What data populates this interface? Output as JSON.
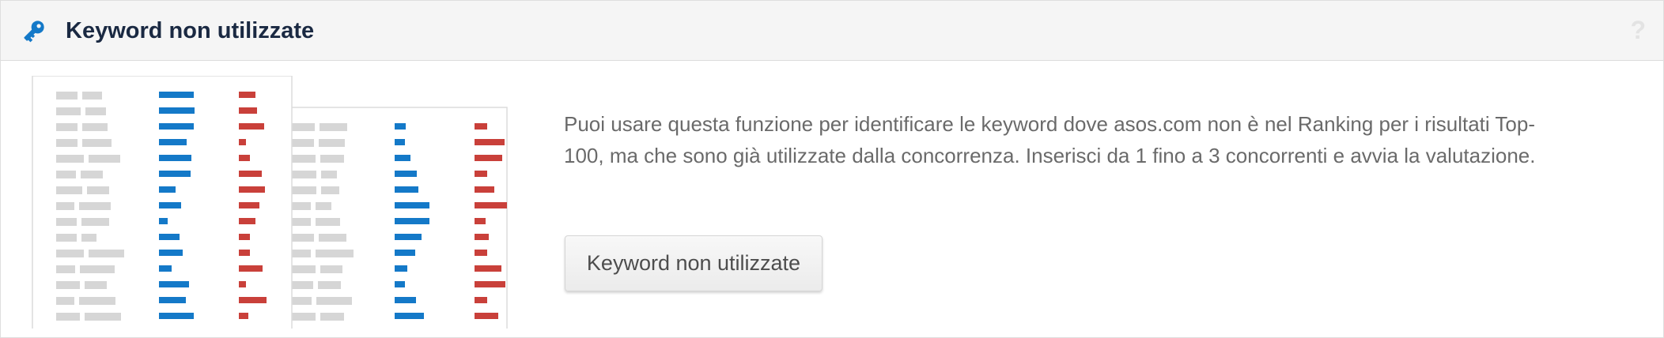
{
  "header": {
    "title": "Keyword non utilizzate",
    "help_label": "?",
    "icon": "key-icon"
  },
  "main": {
    "description": "Puoi usare questa funzione per identificare le keyword dove asos.com non è nel Ranking per i risultati Top-100, ma che sono già utilizzate dalla concorrenza. Inserisci da 1 fino a 3 concorrenti e avvia la valutazione.",
    "button_label": "Keyword non utilizzate",
    "illustration": "keyword-comparison-illustration"
  },
  "colors": {
    "accent_blue": "#1479c8",
    "accent_red": "#c9403a",
    "title": "#1a2942",
    "placeholder_gray": "#d6d6d6"
  }
}
